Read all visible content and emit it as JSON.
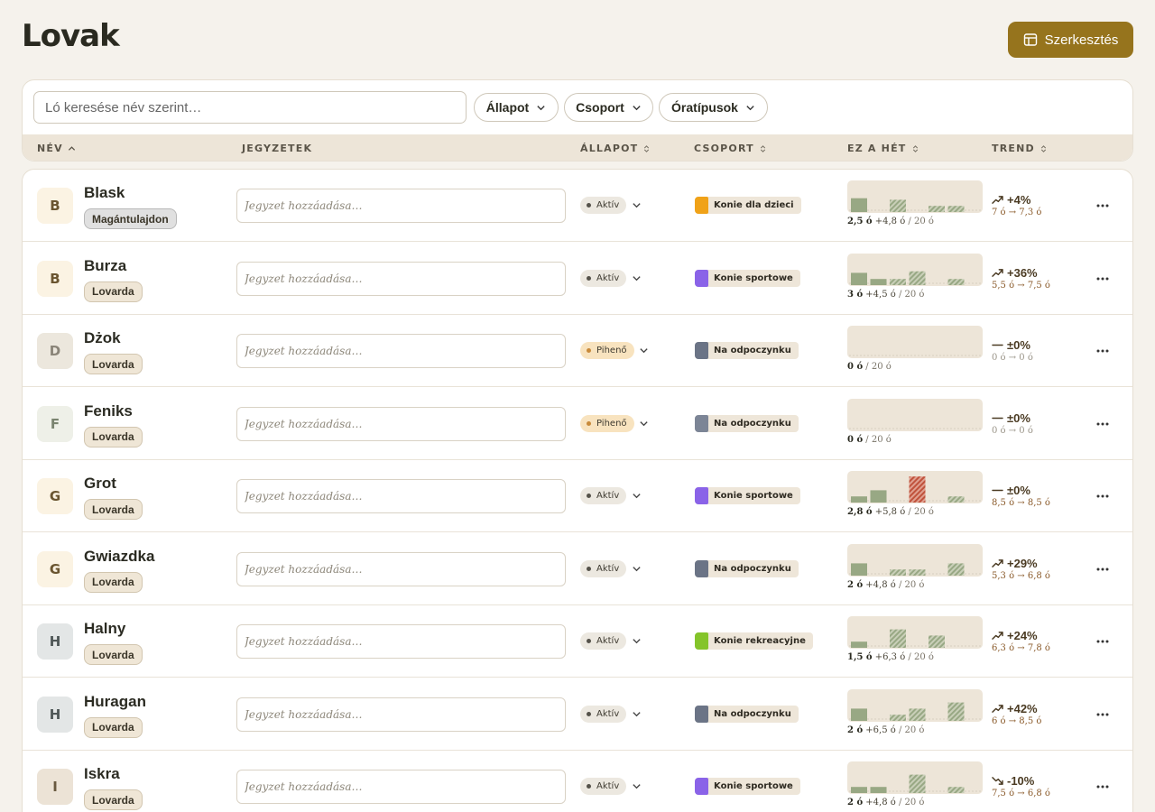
{
  "header": {
    "title": "Lovak",
    "edit_label": "Szerkesztés"
  },
  "search": {
    "placeholder": "Ló keresése név szerint…"
  },
  "filters": [
    "Állapot",
    "Csoport",
    "Óratípusok"
  ],
  "columns": [
    "NÉV",
    "JEGYZETEK",
    "ÁLLAPOT",
    "CSOPORT",
    "EZ A HÉT",
    "TREND"
  ],
  "note_placeholder": "Jegyzet hozzáadása…",
  "colors": {
    "accent": "#96741d",
    "bar": "#98a884",
    "bar_over": "#c0523c",
    "active_dot": "#55524a",
    "resting_dot": "#c88a3a",
    "group_kids": "#f0a218",
    "group_sport": "#8a63e8",
    "group_rest": "#6b7486",
    "group_rec": "#84c42a"
  },
  "horses": [
    {
      "initial": "B",
      "avatar_bg": "#fbf3e3",
      "avatar_fg": "#6a5530",
      "name": "Blask",
      "owner": "Magántulajdon",
      "owner_bg": "#e0e0e0",
      "owner_border": "#b8b8b8",
      "status": "Aktív",
      "status_kind": "active",
      "group": "Konie dla dzieci",
      "group_color": "#f0a218",
      "bars": [
        [
          0.45,
          0
        ],
        [
          0,
          0
        ],
        [
          0.4,
          1
        ],
        [
          0,
          0
        ],
        [
          0.2,
          1
        ],
        [
          0.2,
          1
        ]
      ],
      "week_done": "2,5 ó",
      "week_plan": "+4,8 ó",
      "week_total": "/ 20 ó",
      "trend_icon": "up",
      "trend_pct": "+4%",
      "trend_from_to": "7 ó → 7,3 ó"
    },
    {
      "initial": "B",
      "avatar_bg": "#fbf3e3",
      "avatar_fg": "#6a5530",
      "name": "Burza",
      "owner": "Lovarda",
      "owner_bg": "#efe6d6",
      "owner_border": "#d2c6b0",
      "status": "Aktív",
      "status_kind": "active",
      "group": "Konie sportowe",
      "group_color": "#8a63e8",
      "bars": [
        [
          0.4,
          0
        ],
        [
          0.2,
          0
        ],
        [
          0.2,
          1
        ],
        [
          0.45,
          1
        ],
        [
          0,
          0
        ],
        [
          0.2,
          1
        ]
      ],
      "week_done": "3 ó",
      "week_plan": "+4,5 ó",
      "week_total": "/ 20 ó",
      "trend_icon": "up",
      "trend_pct": "+36%",
      "trend_from_to": "5,5 ó → 7,5 ó"
    },
    {
      "initial": "D",
      "avatar_bg": "#ece7dd",
      "avatar_fg": "#8a8478",
      "name": "Dżok",
      "owner": "Lovarda",
      "owner_bg": "#efe6d6",
      "owner_border": "#d2c6b0",
      "status": "Pihenő",
      "status_kind": "rest",
      "group": "Na odpoczynku",
      "group_color": "#6b7486",
      "bars": [
        [
          0,
          0
        ],
        [
          0,
          0
        ],
        [
          0,
          0
        ],
        [
          0,
          0
        ],
        [
          0,
          0
        ],
        [
          0,
          0
        ]
      ],
      "week_done": "0 ó",
      "week_plan": "",
      "week_total": "/ 20 ó",
      "trend_icon": "flat",
      "trend_pct": "±0%",
      "trend_from_to": "0 ó → 0 ó"
    },
    {
      "initial": "F",
      "avatar_bg": "#eef0e8",
      "avatar_fg": "#7a8470",
      "name": "Feniks",
      "owner": "Lovarda",
      "owner_bg": "#efe6d6",
      "owner_border": "#d2c6b0",
      "status": "Pihenő",
      "status_kind": "rest",
      "group": "Na odpoczynku",
      "group_color": "#7c8596",
      "bars": [
        [
          0,
          0
        ],
        [
          0,
          0
        ],
        [
          0,
          0
        ],
        [
          0,
          0
        ],
        [
          0,
          0
        ],
        [
          0,
          0
        ]
      ],
      "week_done": "0 ó",
      "week_plan": "",
      "week_total": "/ 20 ó",
      "trend_icon": "flat",
      "trend_pct": "±0%",
      "trend_from_to": "0 ó → 0 ó"
    },
    {
      "initial": "G",
      "avatar_bg": "#fbf3e3",
      "avatar_fg": "#6a5530",
      "name": "Grot",
      "owner": "Lovarda",
      "owner_bg": "#efe6d6",
      "owner_border": "#d2c6b0",
      "status": "Aktív",
      "status_kind": "active",
      "group": "Konie sportowe",
      "group_color": "#8a63e8",
      "bars": [
        [
          0.2,
          0
        ],
        [
          0.4,
          0
        ],
        [
          0,
          0
        ],
        [
          0.85,
          2
        ],
        [
          0,
          0
        ],
        [
          0.2,
          1
        ]
      ],
      "week_done": "2,8 ó",
      "week_plan": "+5,8 ó",
      "week_total": "/ 20 ó",
      "trend_icon": "flat",
      "trend_pct": "±0%",
      "trend_from_to": "8,5 ó → 8,5 ó"
    },
    {
      "initial": "G",
      "avatar_bg": "#fbf3e3",
      "avatar_fg": "#6a5530",
      "name": "Gwiazdka",
      "owner": "Lovarda",
      "owner_bg": "#efe6d6",
      "owner_border": "#d2c6b0",
      "status": "Aktív",
      "status_kind": "active",
      "group": "Na odpoczynku",
      "group_color": "#6b7486",
      "bars": [
        [
          0.4,
          0
        ],
        [
          0,
          0
        ],
        [
          0.2,
          1
        ],
        [
          0.2,
          1
        ],
        [
          0,
          0
        ],
        [
          0.4,
          1
        ]
      ],
      "week_done": "2 ó",
      "week_plan": "+4,8 ó",
      "week_total": "/ 20 ó",
      "trend_icon": "up",
      "trend_pct": "+29%",
      "trend_from_to": "5,3 ó → 6,8 ó"
    },
    {
      "initial": "H",
      "avatar_bg": "#e3e6e6",
      "avatar_fg": "#4e5656",
      "name": "Halny",
      "owner": "Lovarda",
      "owner_bg": "#efe6d6",
      "owner_border": "#d2c6b0",
      "status": "Aktív",
      "status_kind": "active",
      "group": "Konie rekreacyjne",
      "group_color": "#84c42a",
      "bars": [
        [
          0.2,
          0
        ],
        [
          0,
          0
        ],
        [
          0.6,
          1
        ],
        [
          0,
          0
        ],
        [
          0.4,
          1
        ],
        [
          0,
          0
        ]
      ],
      "week_done": "1,5 ó",
      "week_plan": "+6,3 ó",
      "week_total": "/ 20 ó",
      "trend_icon": "up",
      "trend_pct": "+24%",
      "trend_from_to": "6,3 ó → 7,8 ó"
    },
    {
      "initial": "H",
      "avatar_bg": "#e3e6e6",
      "avatar_fg": "#4e5656",
      "name": "Huragan",
      "owner": "Lovarda",
      "owner_bg": "#efe6d6",
      "owner_border": "#d2c6b0",
      "status": "Aktív",
      "status_kind": "active",
      "group": "Na odpoczynku",
      "group_color": "#6b7486",
      "bars": [
        [
          0.4,
          0
        ],
        [
          0,
          0
        ],
        [
          0.2,
          1
        ],
        [
          0.4,
          1
        ],
        [
          0,
          0
        ],
        [
          0.6,
          1
        ]
      ],
      "week_done": "2 ó",
      "week_plan": "+6,5 ó",
      "week_total": "/ 20 ó",
      "trend_icon": "up",
      "trend_pct": "+42%",
      "trend_from_to": "6 ó → 8,5 ó"
    },
    {
      "initial": "I",
      "avatar_bg": "#ece3d6",
      "avatar_fg": "#6a5a40",
      "name": "Iskra",
      "owner": "Lovarda",
      "owner_bg": "#efe6d6",
      "owner_border": "#d2c6b0",
      "status": "Aktív",
      "status_kind": "active",
      "group": "Konie sportowe",
      "group_color": "#8a63e8",
      "bars": [
        [
          0.2,
          0
        ],
        [
          0.2,
          0
        ],
        [
          0,
          0
        ],
        [
          0.6,
          1
        ],
        [
          0,
          0
        ],
        [
          0.2,
          1
        ]
      ],
      "week_done": "2 ó",
      "week_plan": "+4,8 ó",
      "week_total": "/ 20 ó",
      "trend_icon": "down",
      "trend_pct": "-10%",
      "trend_from_to": "7,5 ó → 6,8 ó"
    }
  ]
}
